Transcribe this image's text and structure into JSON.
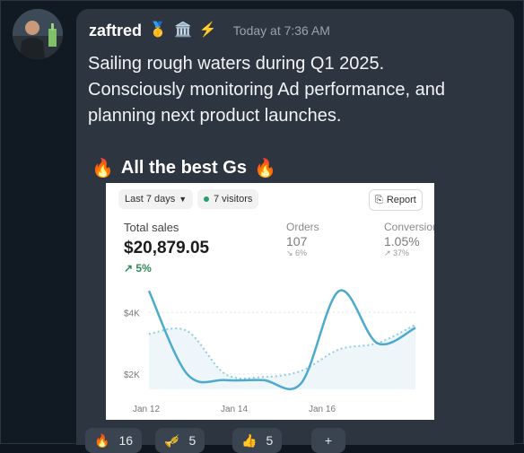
{
  "message": {
    "username": "zaftred",
    "timestamp": "Today at 7:36 AM",
    "badges": [
      "🥇",
      "🏛️",
      "⚡"
    ],
    "text": "Sailing rough waters during Q1 2025.\nConsciously monitoring Ad performance, and\nplanning next product launches.",
    "shout": "All the best Gs",
    "shout_emoji": "🔥"
  },
  "card": {
    "range_label": "Last 7 days",
    "visitors_label": "7 visitors",
    "report_label": "Report",
    "metrics": [
      {
        "label": "Total sales",
        "value": "$20,879.05",
        "delta": "↗ 5%"
      },
      {
        "label": "Orders",
        "value": "107",
        "delta": "↘ 6%"
      },
      {
        "label": "Conversion",
        "value": "1.05%",
        "delta": "↗ 37%"
      }
    ]
  },
  "chart_data": {
    "type": "line",
    "y_tick_labels": [
      "$4K",
      "$2K"
    ],
    "x_tick_labels": [
      "Jan 12",
      "Jan 14",
      "Jan 16"
    ],
    "ylim": [
      1500,
      5000
    ],
    "series": [
      {
        "values": [
          4700,
          2000,
          1800,
          1800,
          1700,
          4700,
          3000,
          3500
        ]
      },
      {
        "values": [
          3300,
          3400,
          2000,
          1900,
          2100,
          2800,
          3000,
          3600
        ]
      }
    ],
    "colors": {
      "current": "#4ea9cf",
      "previous": "#8fcde0"
    }
  },
  "reactions": [
    {
      "emoji": "🔥",
      "count": "16"
    },
    {
      "emoji": "🎺",
      "count": "5"
    },
    {
      "emoji": "👍",
      "count": "5"
    },
    {
      "emoji": "+",
      "count": ""
    }
  ]
}
